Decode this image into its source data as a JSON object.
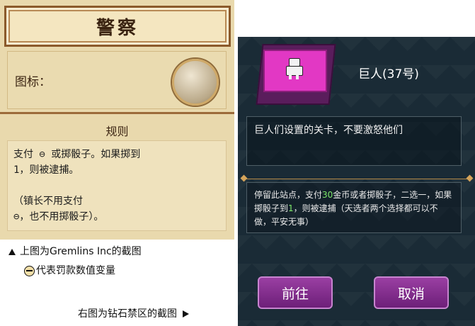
{
  "left": {
    "title": "警察",
    "icon_label": "图标：",
    "icon_name": "police-helmet-medal-icon",
    "rules_title": "规则",
    "rules_text": "支付 ⊖ 或掷骰子。如果掷到\n1，则被逮捕。\n\n（镇长不用支付\n⊖，也不用掷骰子）。"
  },
  "captions": {
    "top_note": "上图为Gremlins Inc的截图",
    "fine_note": "代表罚款数值变量",
    "right_note": "右图为钻石禁区的截图"
  },
  "right": {
    "card_title": "巨人(37号)",
    "card_icon": "robot-icon",
    "quote": "巨人们设置的关卡，不要激怒他们",
    "body_pre": "停留此站点，支付",
    "body_amount": "30",
    "body_mid": "金币或者掷骰子，二选一，如果掷骰子到",
    "body_dice": "1",
    "body_post": "，则被逮捕（天选者两个选择都可以不做，平安无事）",
    "btn_go": "前往",
    "btn_cancel": "取消"
  },
  "colors": {
    "left_bg": "#e9d9ad",
    "right_bg": "#1a2b36",
    "button": "#8a2f93",
    "highlight": "#7de86a"
  }
}
